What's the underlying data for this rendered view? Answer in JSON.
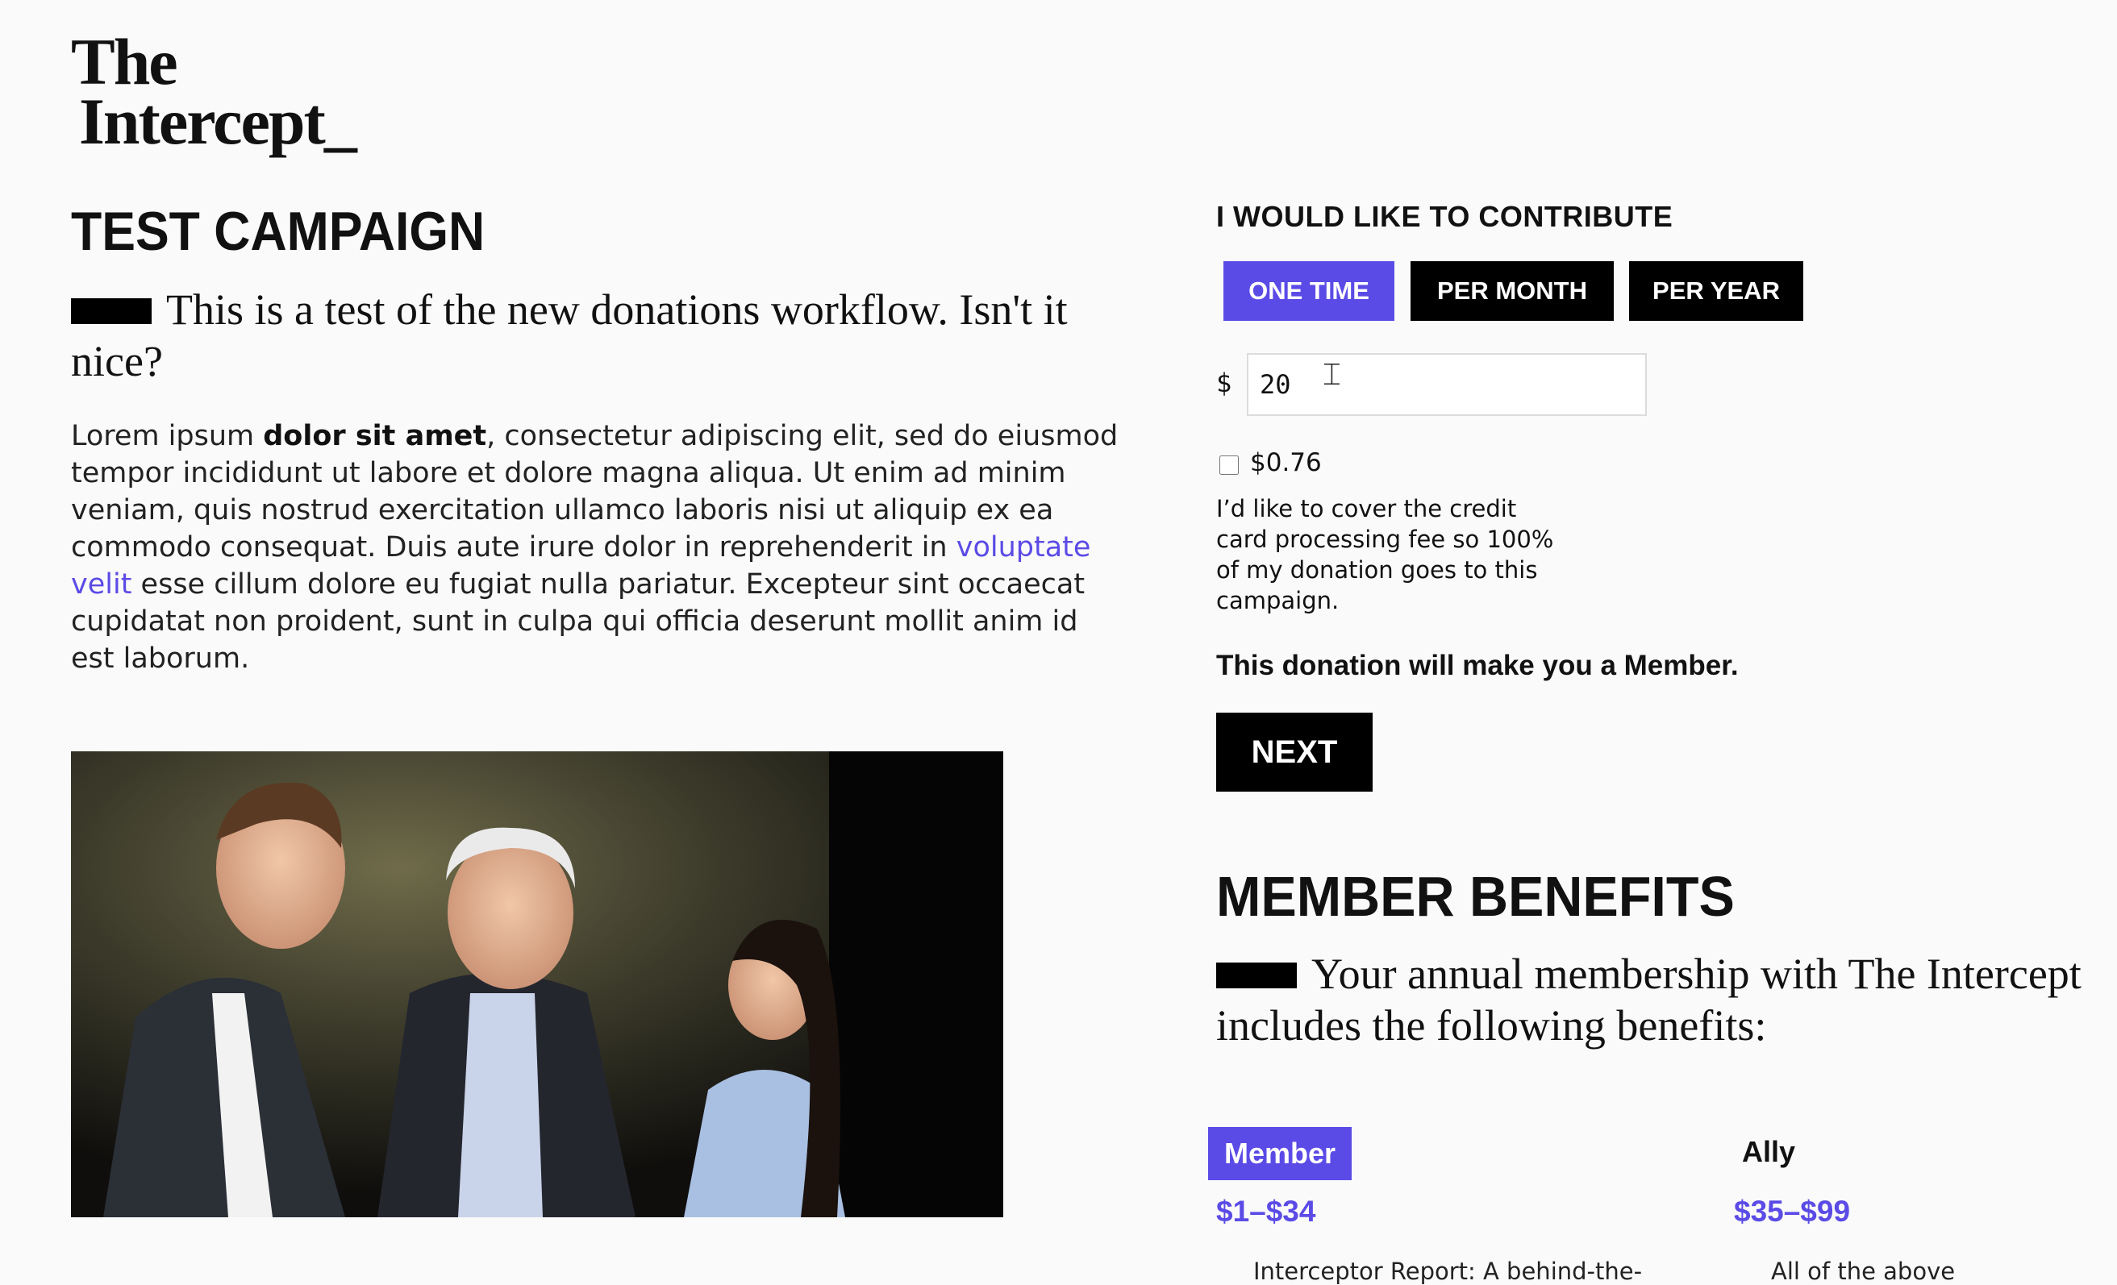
{
  "brand": {
    "logo_line1": "The",
    "logo_line2": "Intercept_"
  },
  "campaign": {
    "title": "TEST CAMPAIGN",
    "intro": "This is a test of the new donations workflow. Isn't it nice?",
    "body_1": "Lorem ipsum ",
    "body_bold": "dolor sit amet",
    "body_2": ", consectetur adipiscing elit, sed do eiusmod tempor incididunt ut labore et dolore magna aliqua. Ut enim ad minim veniam, quis nostrud exercitation ullamco laboris nisi ut aliquip ex ea commodo consequat. Duis aute irure dolor in reprehenderit in ",
    "body_link": "voluptate velit",
    "body_3": " esse cillum dolore eu fugiat nulla pariatur. Excepteur sint occaecat cupidatat non proident, sunt in culpa qui officia deserunt mollit anim id est laborum."
  },
  "contribute": {
    "heading": "I WOULD LIKE TO CONTRIBUTE",
    "frequencies": [
      "ONE TIME",
      "PER MONTH",
      "PER YEAR"
    ],
    "selected_frequency": "ONE TIME",
    "currency_symbol": "$",
    "amount": "20",
    "fee_checked": false,
    "fee_amount": "$0.76",
    "fee_text": "I’d like to cover the credit card processing fee so 100% of my donation goes to this campaign.",
    "member_note": "This donation will make you a Member.",
    "next_label": "NEXT"
  },
  "benefits": {
    "heading": "MEMBER BENEFITS",
    "intro": "Your annual membership with The Intercept includes the following benefits:",
    "tiers": [
      {
        "name": "Member",
        "range": "$1–$34",
        "description": "Interceptor Report: A behind-the-"
      },
      {
        "name": "Ally",
        "range": "$35–$99",
        "description": "All of the above"
      }
    ]
  },
  "colors": {
    "accent": "#5b4be6",
    "black": "#000000",
    "background": "#fafafa"
  }
}
